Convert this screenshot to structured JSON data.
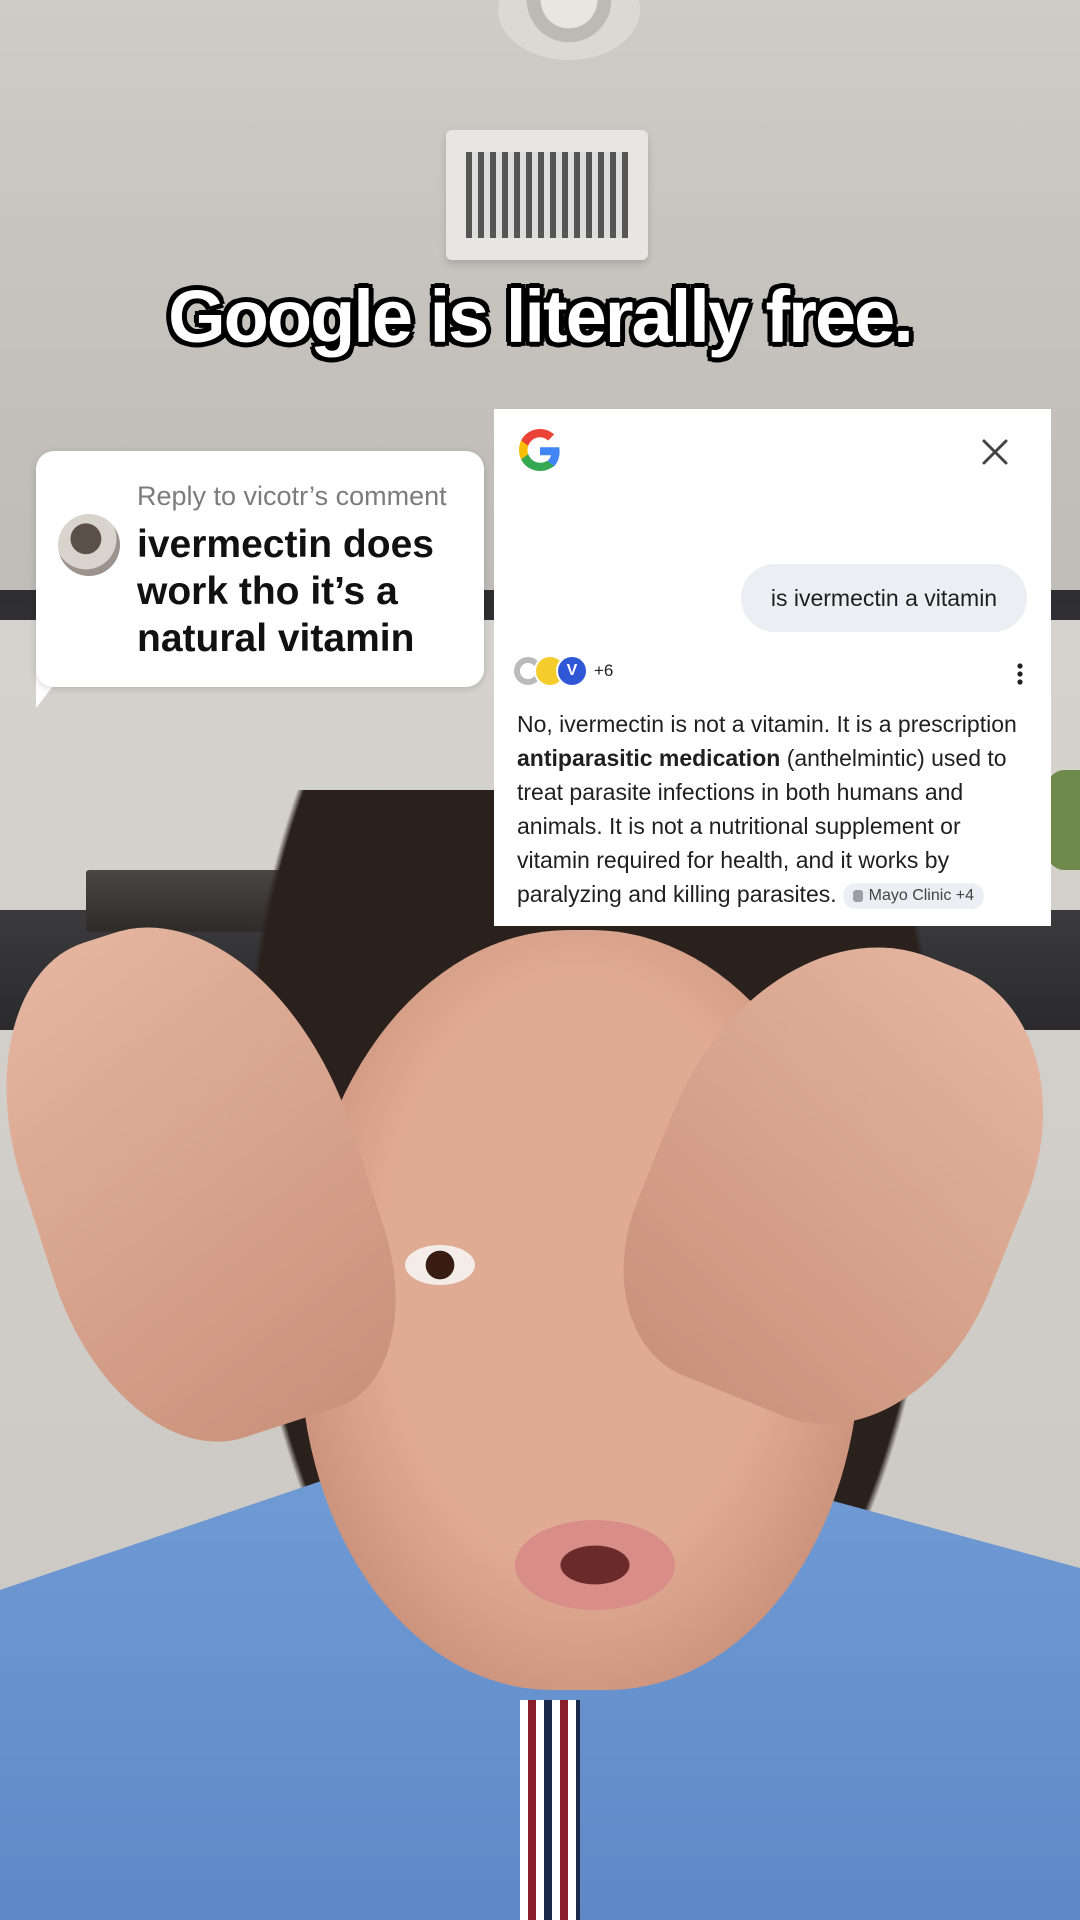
{
  "caption": {
    "text": "Google is literally free."
  },
  "reply": {
    "header": "Reply to vicotr’s comment",
    "comment": "ivermectin does work tho it’s a natural vitamin"
  },
  "google": {
    "query": "is ivermectin a vitamin",
    "sources_more": "+6",
    "source_letter": "V",
    "answer_part1": "No, ivermectin is not a vitamin. It is a prescription ",
    "answer_bold": "antiparasitic medication",
    "answer_part2": " (anthelmintic) used to treat parasite infections in both humans and animals. It is not a nutritional supplement or vitamin required for health, and it works by paralyzing and killing parasites.",
    "citation": "Mayo Clinic +4"
  },
  "colors": {
    "google_blue": "#4285F4",
    "google_red": "#EA4335",
    "google_yellow": "#FBBC05",
    "google_green": "#34A853",
    "query_bubble": "#eceef3"
  }
}
